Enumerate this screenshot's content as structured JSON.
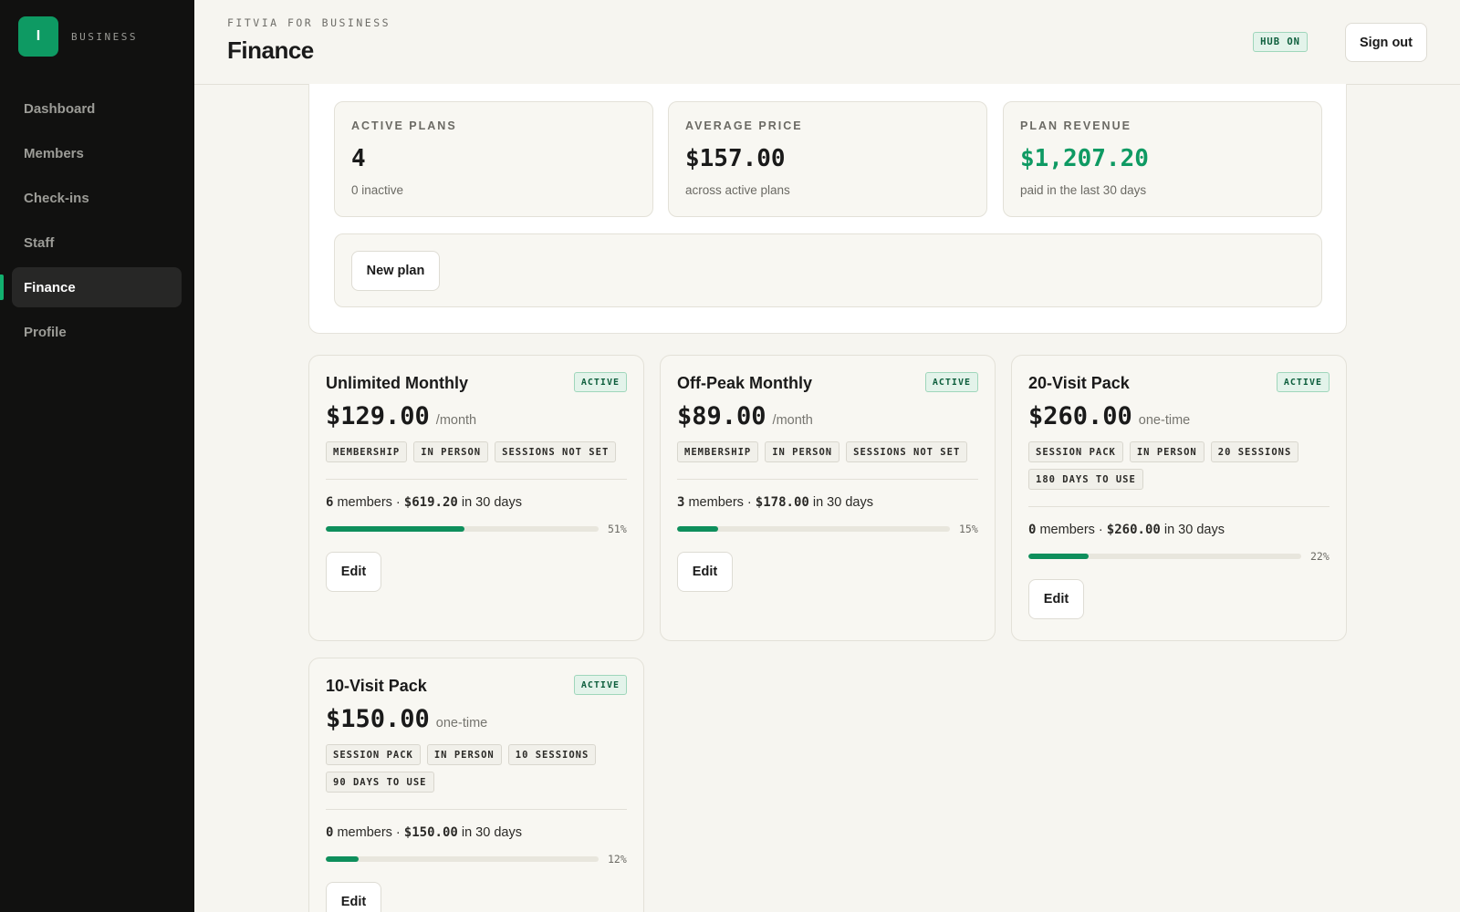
{
  "brand": {
    "logo_letter": "I",
    "label": "BUSINESS"
  },
  "sidebar": {
    "items": [
      {
        "label": "Dashboard",
        "active": false
      },
      {
        "label": "Members",
        "active": false
      },
      {
        "label": "Check-ins",
        "active": false
      },
      {
        "label": "Staff",
        "active": false
      },
      {
        "label": "Finance",
        "active": true
      },
      {
        "label": "Profile",
        "active": false
      }
    ]
  },
  "header": {
    "eyebrow": "FITVIA FOR BUSINESS",
    "title": "Finance",
    "hub_badge": "HUB ON",
    "signout_label": "Sign out"
  },
  "stats": [
    {
      "label": "ACTIVE PLANS",
      "value": "4",
      "sub": "0 inactive",
      "accent": false
    },
    {
      "label": "AVERAGE PRICE",
      "value": "$157.00",
      "sub": "across active plans",
      "accent": false
    },
    {
      "label": "PLAN REVENUE",
      "value": "$1,207.20",
      "sub": "paid in the last 30 days",
      "accent": true
    }
  ],
  "actions": {
    "new_plan_label": "New plan"
  },
  "colors": {
    "accent": "#0e9a63",
    "sidebar_bg": "#111110",
    "page_bg": "#f6f5f0"
  },
  "plans": [
    {
      "name": "Unlimited Monthly",
      "status": "ACTIVE",
      "price": "$129.00",
      "period": "/month",
      "tags": [
        "MEMBERSHIP",
        "IN PERSON",
        "SESSIONS NOT SET"
      ],
      "members": "6",
      "members_label": "members ·",
      "revenue": "$619.20",
      "revenue_label": "in 30 days",
      "share": 0.51,
      "share_label": "51%",
      "edit_label": "Edit"
    },
    {
      "name": "Off-Peak Monthly",
      "status": "ACTIVE",
      "price": "$89.00",
      "period": "/month",
      "tags": [
        "MEMBERSHIP",
        "IN PERSON",
        "SESSIONS NOT SET"
      ],
      "members": "3",
      "members_label": "members ·",
      "revenue": "$178.00",
      "revenue_label": "in 30 days",
      "share": 0.15,
      "share_label": "15%",
      "edit_label": "Edit"
    },
    {
      "name": "20-Visit Pack",
      "status": "ACTIVE",
      "price": "$260.00",
      "period": "one-time",
      "tags": [
        "SESSION PACK",
        "IN PERSON",
        "20 SESSIONS",
        "180 DAYS TO USE"
      ],
      "members": "0",
      "members_label": "members ·",
      "revenue": "$260.00",
      "revenue_label": "in 30 days",
      "share": 0.22,
      "share_label": "22%",
      "edit_label": "Edit"
    },
    {
      "name": "10-Visit Pack",
      "status": "ACTIVE",
      "price": "$150.00",
      "period": "one-time",
      "tags": [
        "SESSION PACK",
        "IN PERSON",
        "10 SESSIONS",
        "90 DAYS TO USE"
      ],
      "members": "0",
      "members_label": "members ·",
      "revenue": "$150.00",
      "revenue_label": "in 30 days",
      "share": 0.12,
      "share_label": "12%",
      "edit_label": "Edit"
    }
  ]
}
